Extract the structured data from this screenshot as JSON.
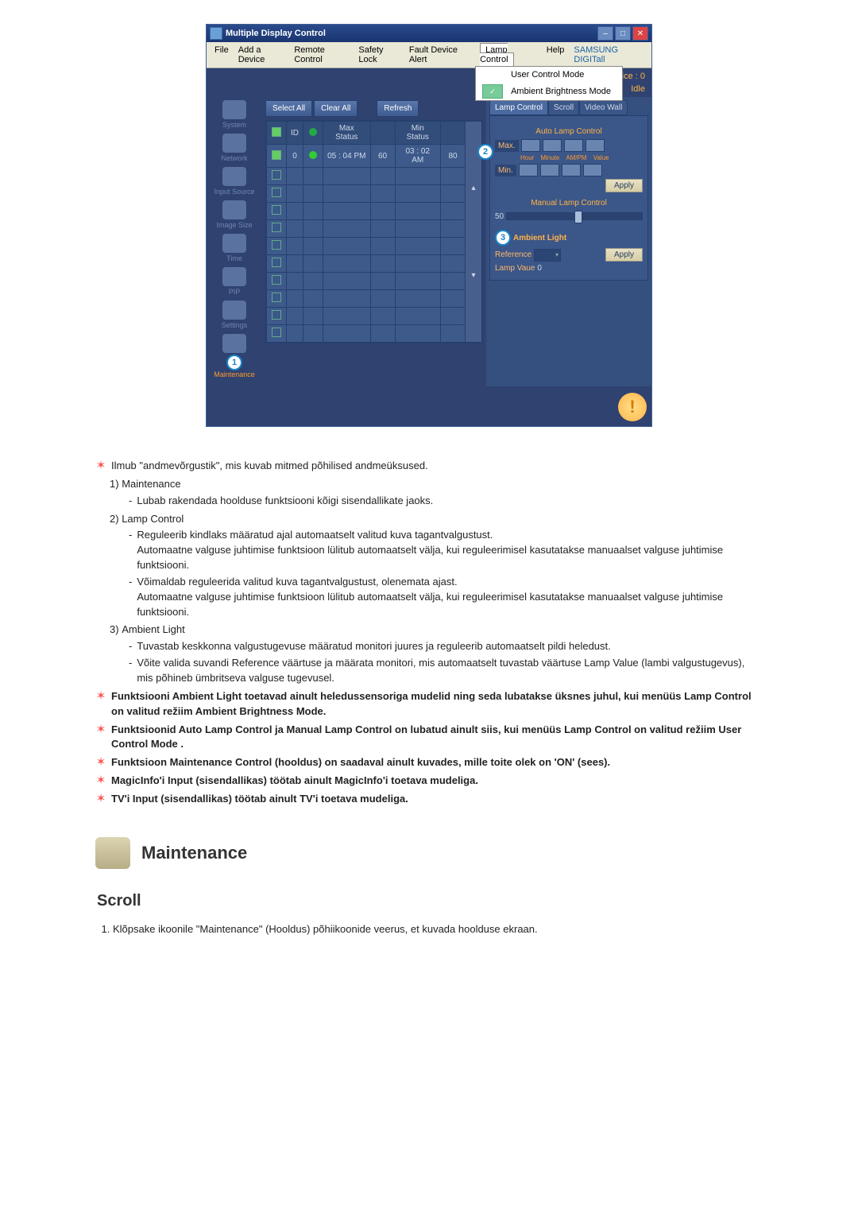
{
  "app": {
    "title": "Multiple Display Control",
    "menu": {
      "file": "File",
      "add_device": "Add a Device",
      "remote_control": "Remote Control",
      "safety_lock": "Safety Lock",
      "fault_device_alert": "Fault Device Alert",
      "lamp_control": "Lamp Control",
      "help": "Help",
      "brand": "SAMSUNG DIGITall"
    },
    "lamp_menu": {
      "user_control_mode": "User Control Mode",
      "ambient_brightness_mode": "Ambient Brightness Mode"
    },
    "status": {
      "device_label": "Device : 0",
      "idle": "Idle"
    },
    "sidebar": {
      "system": "System",
      "network": "Network",
      "input_source": "Input Source",
      "image_size": "Image Size",
      "time": "Time",
      "pip": "PIP",
      "settings": "Settings",
      "maintenance": "Maintenance"
    },
    "buttons": {
      "select_all": "Select All",
      "clear_all": "Clear All",
      "refresh": "Refresh"
    },
    "grid": {
      "headers": {
        "id": "ID",
        "max_status": "Max Status",
        "min_status": "Min Status"
      },
      "row": {
        "id": "0",
        "max_status": "05 : 04  PM",
        "min_col": "60",
        "min_status": "03 : 02  AM",
        "last": "80"
      }
    },
    "panel": {
      "tabs": {
        "lamp_control": "Lamp Control",
        "scroll": "Scroll",
        "video_wall": "Video Wall"
      },
      "auto_lamp_title": "Auto Lamp Control",
      "max": "Max.",
      "min": "Min.",
      "time_labels": {
        "hour": "Hour",
        "minute": "Minute",
        "ampm": "AM/PM",
        "value": "Value"
      },
      "apply": "Apply",
      "manual_lamp_title": "Manual Lamp Control",
      "manual_value": "50",
      "ambient_title": "Ambient Light",
      "reference": "Reference",
      "lamp_value_label": "Lamp Vaue",
      "lamp_value": "0"
    },
    "badges": {
      "one": "1",
      "two": "2",
      "three": "3"
    }
  },
  "doc": {
    "intro": "Ilmub \"andmevõrgustik\", mis kuvab mitmed põhilised andmeüksused.",
    "items": [
      {
        "num": "1)",
        "title": "Maintenance",
        "subs": [
          "Lubab rakendada hoolduse funktsiooni kõigi sisendallikate jaoks."
        ]
      },
      {
        "num": "2)",
        "title": "Lamp Control",
        "subs": [
          "Reguleerib kindlaks määratud ajal automaatselt valitud kuva tagantvalgustust.\nAutomaatne valguse juhtimise funktsioon lülitub automaatselt välja, kui reguleerimisel kasutatakse manuaalset valguse juhtimise funktsiooni.",
          "Võimaldab reguleerida valitud kuva tagantvalgustust, olenemata ajast.\nAutomaatne valguse juhtimise funktsioon lülitub automaatselt välja, kui reguleerimisel kasutatakse manuaalset valguse juhtimise funktsiooni."
        ]
      },
      {
        "num": "3)",
        "title": "Ambient Light",
        "subs": [
          "Tuvastab keskkonna valgustugevuse määratud monitori juures ja reguleerib automaatselt pildi heledust.",
          "Võite valida suvandi Reference väärtuse ja määrata monitori, mis automaatselt tuvastab väärtuse Lamp Value (lambi valgustugevus), mis põhineb ümbritseva valguse tugevusel."
        ]
      }
    ],
    "stars": [
      "Funktsiooni Ambient Light toetavad ainult heledussensoriga mudelid ning seda lubatakse üksnes juhul, kui menüüs Lamp Control on valitud režiim Ambient Brightness Mode.",
      "Funktsioonid Auto Lamp Control ja Manual Lamp Control on lubatud ainult siis, kui menüüs Lamp Control on valitud režiim User Control Mode .",
      "Funktsioon Maintenance Control (hooldus) on saadaval ainult kuvades, mille toite olek on 'ON' (sees).",
      "MagicInfo'i Input (sisendallikas) töötab ainult MagicInfo'i toetava mudeliga.",
      "TV'i Input (sisendallikas) töötab ainult TV'i toetava mudeliga."
    ],
    "heading": "Maintenance",
    "subheading": "Scroll",
    "scroll_steps": [
      "Klõpsake ikoonile \"Maintenance\" (Hooldus) põhiikoonide veerus, et kuvada hoolduse ekraan."
    ]
  }
}
